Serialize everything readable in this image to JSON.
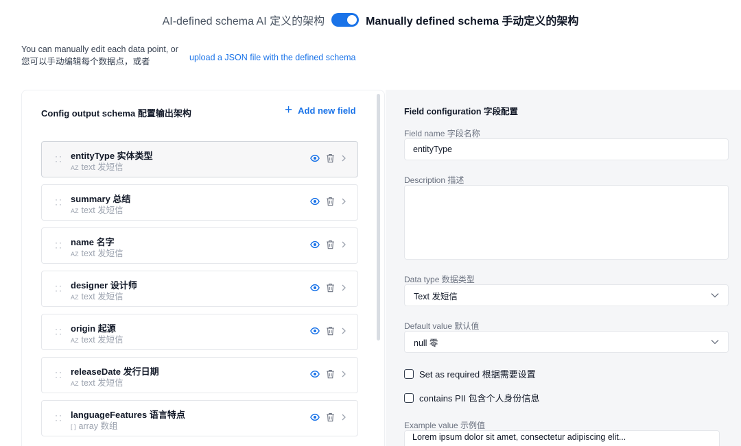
{
  "toggle": {
    "left_label": "AI-defined schema AI 定义的架构",
    "right_label": "Manually defined schema 手动定义的架构",
    "accent": "#1a73e8",
    "state": "manual"
  },
  "intro": {
    "line1": "You can manually edit each data point, or",
    "line2": "您可以手动编辑每个数据点，或者",
    "link": "upload a JSON file with the defined schema"
  },
  "left_panel": {
    "title": "Config output schema 配置输出架构",
    "add_label": "Add new field",
    "fields": [
      {
        "name": "entityType 实体类型",
        "type": "text 发短信",
        "type_glyph": "AZ",
        "selected": true
      },
      {
        "name": "summary 总结",
        "type": "text 发短信",
        "type_glyph": "AZ",
        "selected": false
      },
      {
        "name": "name 名字",
        "type": "text 发短信",
        "type_glyph": "AZ",
        "selected": false
      },
      {
        "name": "designer 设计师",
        "type": "text 发短信",
        "type_glyph": "AZ",
        "selected": false
      },
      {
        "name": "origin 起源",
        "type": "text 发短信",
        "type_glyph": "AZ",
        "selected": false
      },
      {
        "name": "releaseDate 发行日期",
        "type": "text 发短信",
        "type_glyph": "AZ",
        "selected": false
      },
      {
        "name": "languageFeatures 语言特点",
        "type": "array 数组",
        "type_glyph": "[ ]",
        "selected": false
      }
    ]
  },
  "right_panel": {
    "title": "Field configuration 字段配置",
    "field_name_label": "Field name 字段名称",
    "field_name_value": "entityType",
    "description_label": "Description 描述",
    "description_value": "",
    "data_type_label": "Data type 数据类型",
    "data_type_value": "Text 发短信",
    "default_value_label": "Default value 默认值",
    "default_value_value": "null 零",
    "required_label": "Set as required 根据需要设置",
    "required_checked": false,
    "pii_label": "contains PII 包含个人身份信息",
    "pii_checked": false,
    "example_label": "Example value 示例值",
    "example_value": "Lorem ipsum dolor sit amet, consectetur adipiscing elit..."
  }
}
